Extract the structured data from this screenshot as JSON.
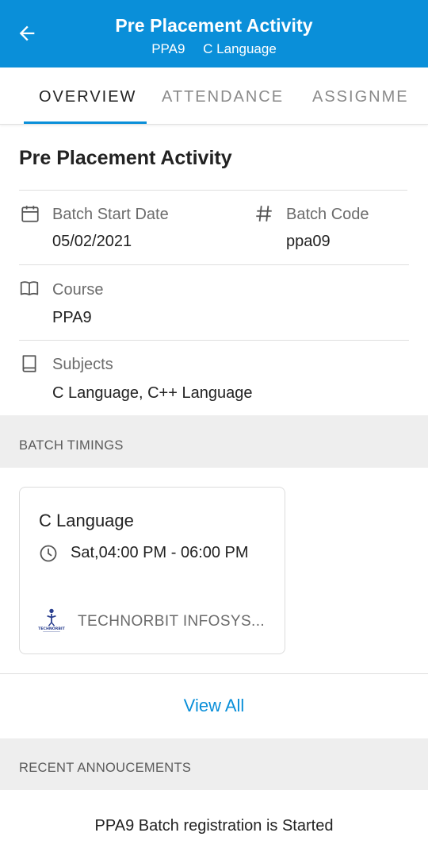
{
  "header": {
    "title": "Pre Placement Activity",
    "subtitle_code": "PPA9",
    "subtitle_subject": "C Language",
    "bar_color": "#0a8fd9"
  },
  "tabs": [
    {
      "label": "OVERVIEW",
      "active": true
    },
    {
      "label": "ATTENDANCE",
      "active": false
    },
    {
      "label": "ASSIGNME",
      "active": false
    }
  ],
  "overview": {
    "batch_name": "Pre Placement Activity",
    "start_date": {
      "label": "Batch Start Date",
      "value": "05/02/2021",
      "icon": "calendar-icon"
    },
    "batch_code": {
      "label": "Batch Code",
      "value": "ppa09",
      "icon": "hash-icon"
    },
    "course": {
      "label": "Course",
      "value": "PPA9",
      "icon": "open-book-icon"
    },
    "subjects": {
      "label": "Subjects",
      "value": "C Language, C++ Language",
      "icon": "book-icon"
    }
  },
  "batch_timings": {
    "heading": "BATCH TIMINGS",
    "cards": [
      {
        "subject": "C Language",
        "time": "Sat,04:00 PM - 06:00 PM",
        "institute": "TECHNORBIT INFOSYS...",
        "logo_text": "TECHNORBIT"
      }
    ],
    "view_all": "View All"
  },
  "recent_announcements": {
    "heading": "RECENT ANNOUCEMENTS",
    "items": [
      "PPA9 Batch registration is Started"
    ]
  }
}
